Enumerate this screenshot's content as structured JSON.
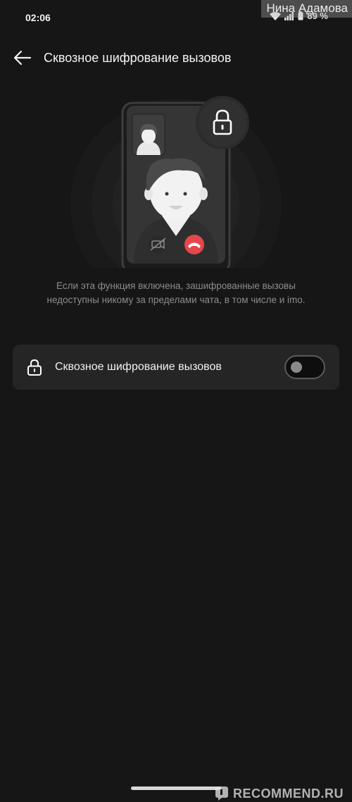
{
  "status_bar": {
    "time": "02:06",
    "battery": "89 %"
  },
  "watermark_top": "Нина Адамова",
  "header": {
    "title": "Сквозное шифрование вызовов"
  },
  "description": {
    "line1": "Если эта функция включена, зашифрованные вызовы",
    "line2": "недоступны никому за пределами чата, в том числе и imo."
  },
  "setting": {
    "label": "Сквозное шифрование вызовов",
    "enabled": false,
    "icon": "lock-icon"
  },
  "watermark_bottom": "RECOMMEND.RU",
  "colors": {
    "background": "#161616",
    "card": "#252525",
    "end_call": "#e5474b"
  }
}
